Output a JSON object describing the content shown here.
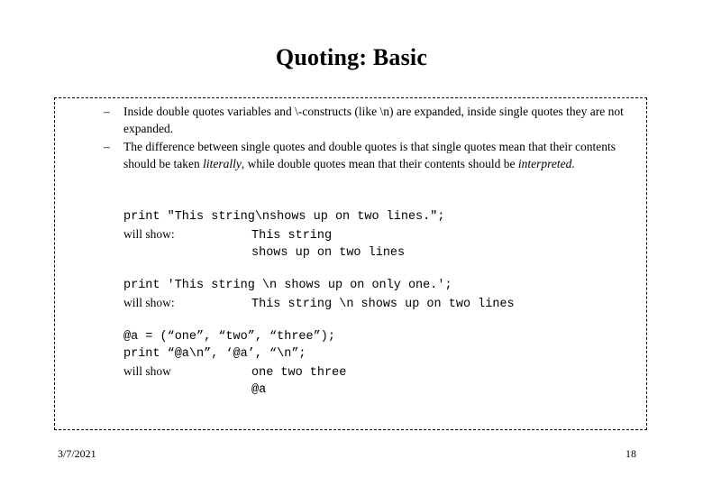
{
  "slide": {
    "title": "Quoting: Basic",
    "page_number": "18",
    "date": "3/7/2021",
    "bullet_marker": "–"
  },
  "bullets": [
    {
      "marker": "–",
      "segments": [
        {
          "text": "Inside double quotes variables and \\-constructs (like \\n) are expanded, inside single quotes they are not expanded.",
          "style": "normal"
        }
      ]
    },
    {
      "marker": "–",
      "segments": [
        {
          "text": "The difference between single quotes and double quotes is that single quotes mean that their contents should be taken ",
          "style": "normal"
        },
        {
          "text": "literally",
          "style": "italic"
        },
        {
          "text": ", while double quotes mean that their contents should be ",
          "style": "normal"
        },
        {
          "text": "interpreted",
          "style": "italic"
        },
        {
          "text": ".",
          "style": "normal"
        }
      ]
    }
  ],
  "code_blocks": [
    {
      "id": "block-1",
      "lines": [
        {
          "type": "code",
          "text": "print \"This string\\nshows up on two lines.\";"
        },
        {
          "type": "mixed",
          "label": "will show:",
          "output": "This string"
        },
        {
          "type": "indent",
          "text": "shows up on two lines"
        }
      ]
    },
    {
      "id": "block-2",
      "lines": [
        {
          "type": "code",
          "text": "print 'This string \\n shows up on only one.';"
        },
        {
          "type": "mixed",
          "label": "will show:",
          "output": "This string \\n shows up on two lines"
        }
      ]
    },
    {
      "id": "block-3",
      "lines": [
        {
          "type": "code",
          "text": "@a = (“one”, “two”, “three”);"
        },
        {
          "type": "code",
          "text": "print “@a\\n”, ‘@a’, “\\n”;"
        },
        {
          "type": "mixed",
          "label": "will show",
          "output": "one two three"
        },
        {
          "type": "indent",
          "text": "@a"
        }
      ]
    }
  ]
}
